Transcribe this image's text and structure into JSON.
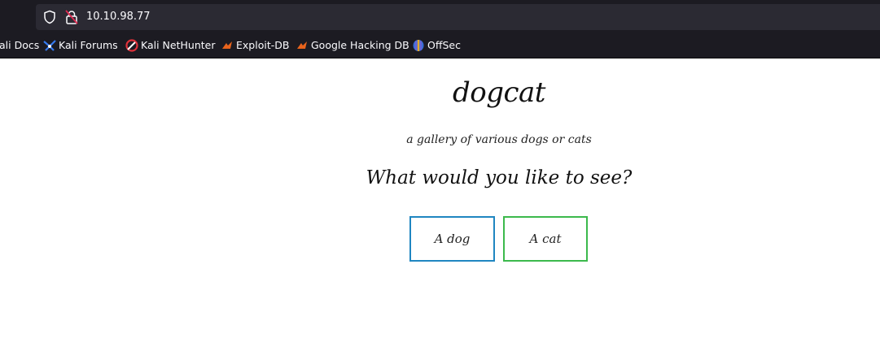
{
  "browser": {
    "url": "10.10.98.77",
    "bookmarks": [
      {
        "label": "ali Docs",
        "icon": "kali-icon"
      },
      {
        "label": "Kali Forums",
        "icon": "kali-dragon-icon"
      },
      {
        "label": "Kali NetHunter",
        "icon": "nethunter-icon"
      },
      {
        "label": "Exploit-DB",
        "icon": "exploit-db-icon"
      },
      {
        "label": "Google Hacking DB",
        "icon": "ghdb-icon"
      },
      {
        "label": "OffSec",
        "icon": "offsec-icon"
      }
    ]
  },
  "page": {
    "title": "dogcat",
    "subtitle": "a gallery of various dogs or cats",
    "question": "What would you like to see?",
    "buttons": {
      "dog": "A dog",
      "cat": "A cat"
    }
  },
  "colors": {
    "dog_border": "#1f86c1",
    "cat_border": "#3cb94c",
    "chrome_bg": "#1c1b22",
    "urlbar_bg": "#2b2a33"
  }
}
